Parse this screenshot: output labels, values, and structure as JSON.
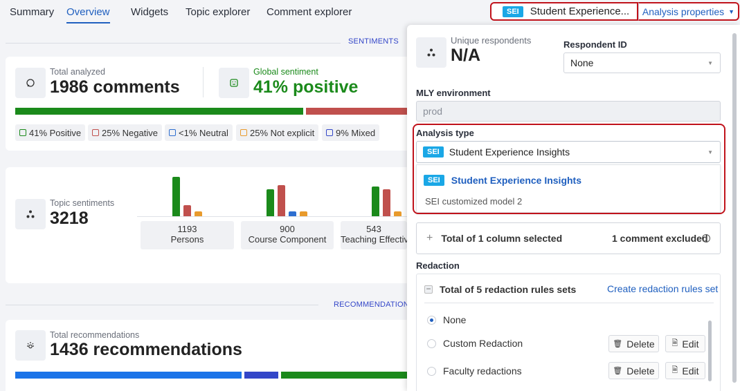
{
  "nav": {
    "tabs": [
      "Summary",
      "Overview",
      "Widgets",
      "Topic explorer",
      "Comment explorer"
    ],
    "active_tab": "Overview",
    "model_badge": "SEI",
    "model_selector": "Student Experience...",
    "properties_button": "Analysis properties"
  },
  "sections": {
    "sentiments": "SENTIMENTS",
    "recommendations": "RECOMMENDATION"
  },
  "analyzed": {
    "label": "Total analyzed",
    "value": "1986 comments",
    "global_label": "Global sentiment",
    "global_value": "41% positive"
  },
  "sentiment_chips": [
    {
      "label": "41% Positive",
      "color": "#1b8a1b"
    },
    {
      "label": "25% Negative",
      "color": "#c0504d"
    },
    {
      "label": "<1% Neutral",
      "color": "#2e6fd0"
    },
    {
      "label": "25% Not explicit",
      "color": "#e89a2c"
    },
    {
      "label": "9% Mixed",
      "color": "#3346c8"
    }
  ],
  "topics": {
    "label": "Topic sentiments",
    "value": "3218",
    "items": [
      {
        "count": "1193",
        "name": "Persons"
      },
      {
        "count": "900",
        "name": "Course Component"
      },
      {
        "count": "543",
        "name": "Teaching Effectiveness"
      }
    ]
  },
  "recommendations": {
    "label": "Total recommendations",
    "value": "1436 recommendations"
  },
  "panel": {
    "unique_label": "Unique respondents",
    "unique_value": "N/A",
    "respondent_id_label": "Respondent ID",
    "respondent_id_value": "None",
    "env_label": "MLY environment",
    "env_value": "prod",
    "analysis_type_label": "Analysis type",
    "analysis_type_badge": "SEI",
    "analysis_type_value": "Student Experience Insights",
    "dropdown_option_badge": "SEI",
    "dropdown_option_label": "Student Experience Insights",
    "dropdown_option_sub": "SEI customized model 2",
    "columns_summary": "Total of 1 column selected",
    "comments_excluded": "1 comment excluded",
    "redaction_label": "Redaction",
    "redaction_total": "Total of 5 redaction rules sets",
    "create_redaction": "Create redaction rules set",
    "redaction_rules": [
      {
        "name": "None",
        "selected": true
      },
      {
        "name": "Custom Redaction",
        "selected": false
      },
      {
        "name": "Faculty redactions",
        "selected": false
      }
    ],
    "delete_label": "Delete",
    "edit_label": "Edit"
  },
  "colors": {
    "accent": "#1f5fbf",
    "positive": "#1b8a1b",
    "negative": "#c0504d",
    "neutral": "#2e6fd0",
    "not_explicit": "#e89a2c",
    "mixed": "#3346c8",
    "highlight": "#c0121b"
  }
}
